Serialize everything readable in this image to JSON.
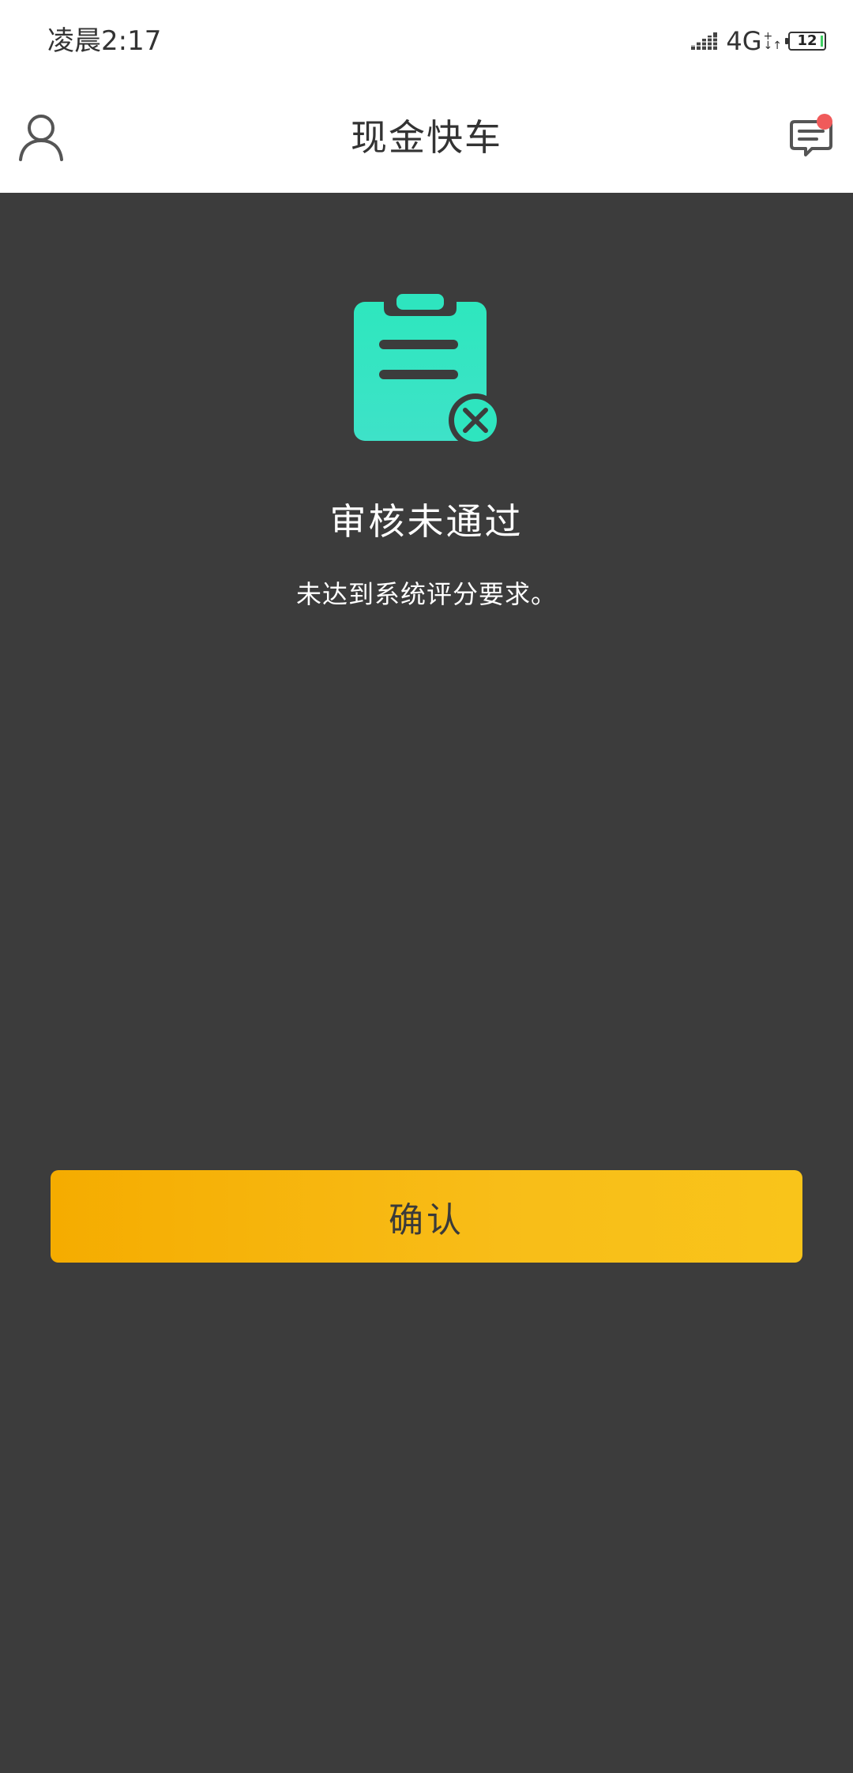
{
  "status_bar": {
    "time": "凌晨2:17",
    "network": "4G",
    "network_sup_top": "+",
    "network_sup_bottom": "↓↑",
    "battery_level": "12",
    "icons": [
      "signal-icon",
      "battery-icon"
    ]
  },
  "header": {
    "title": "现金快车",
    "left_icon": "user-profile-icon",
    "right_icon": "message-icon",
    "has_unread_badge": true
  },
  "result": {
    "icon": "clipboard-rejected-icon",
    "icon_color": "#2ee5bf",
    "title": "审核未通过",
    "description": "未达到系统评分要求。"
  },
  "actions": {
    "confirm_label": "确认",
    "button_color": "#f7b50d"
  },
  "colors": {
    "background": "#3c3c3c",
    "header_background": "#ffffff",
    "badge": "#f05a5a"
  }
}
